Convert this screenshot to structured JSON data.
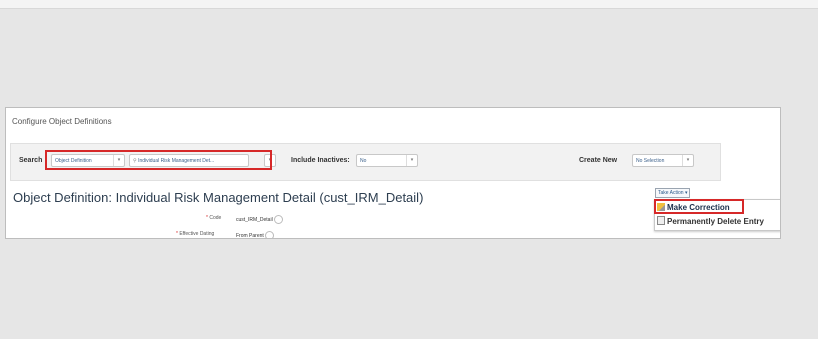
{
  "panel": {
    "title": "Configure Object Definitions"
  },
  "search": {
    "label": "Search",
    "type_select": "Object Definition",
    "object_select": "Individual Risk Management Det...",
    "include_inactives_label": "Include Inactives:",
    "include_inactives_value": "No",
    "create_new_label": "Create New",
    "create_new_value": "No Selection"
  },
  "object": {
    "title": "Object Definition: Individual Risk Management Detail (cust_IRM_Detail)",
    "code_label": "Code",
    "code_value": "cust_IRM_Detail",
    "effective_dating_label": "Effective Dating",
    "effective_dating_value": "From Parent"
  },
  "actions": {
    "take_action_label": "Take Action ▾",
    "menu": [
      {
        "label": "Make Correction",
        "highlighted": true
      },
      {
        "label": "Permanently Delete Entry",
        "highlighted": false
      }
    ]
  },
  "colors": {
    "highlight_box": "#d62828",
    "title_text": "#2d3e50"
  }
}
